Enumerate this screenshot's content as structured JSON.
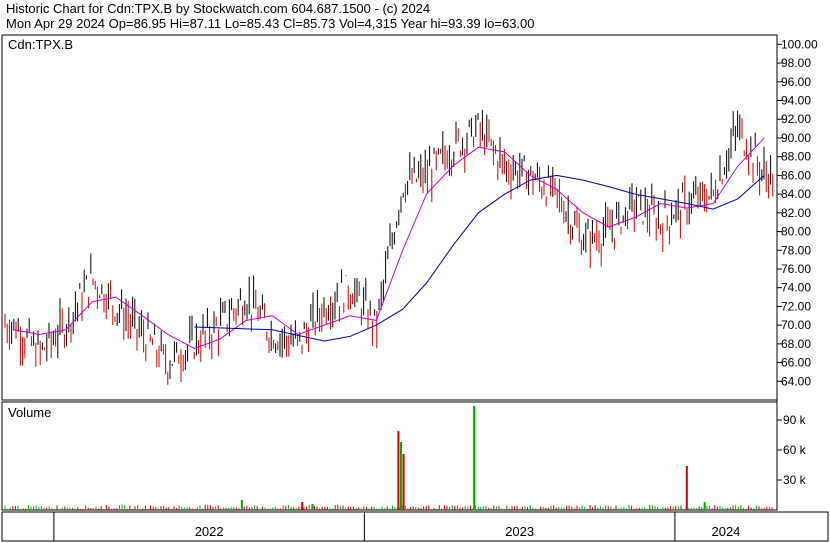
{
  "header": {
    "title_line": "Historic Chart for Cdn:TPX.B by Stockwatch.com 604.687.1500 - (c) 2024",
    "stats_line": "Mon Apr 29 2024   Op=86.95   Hi=87.11   Lo=85.43   Cl=85.73   Vol=4,315   Year hi=93.39   lo=63.00"
  },
  "colors": {
    "bar_up": "#000000",
    "bar_down": "#cc0000",
    "ma_short": "#cc00cc",
    "ma_long": "#0000aa",
    "volume_up": "#00aa00",
    "volume_down": "#cc0000",
    "frame": "#000000",
    "grid": "#c0c0c0"
  },
  "chart_data": [
    {
      "type": "line",
      "label": "Cdn:TPX.B",
      "y_axis_side": "right",
      "ylim": [
        62.0,
        101.0
      ],
      "yticks": [
        "100.00",
        "98.00",
        "96.00",
        "94.00",
        "92.00",
        "90.00",
        "88.00",
        "86.00",
        "84.00",
        "82.00",
        "80.00",
        "78.00",
        "76.00",
        "74.00",
        "72.00",
        "70.00",
        "68.00",
        "66.00",
        "64.00"
      ],
      "x_period_labels": [
        "2022",
        "2023",
        "2024"
      ],
      "series": [
        {
          "kind": "price",
          "x": [
            "2021-11",
            "2021-12",
            "2022-01",
            "2022-02",
            "2022-03",
            "2022-04",
            "2022-05",
            "2022-06",
            "2022-07",
            "2022-08",
            "2022-09",
            "2022-10",
            "2022-11",
            "2022-12",
            "2023-01",
            "2023-02",
            "2023-03",
            "2023-04",
            "2023-05",
            "2023-06",
            "2023-07",
            "2023-08",
            "2023-09",
            "2023-10",
            "2023-11",
            "2023-12",
            "2024-01",
            "2024-02",
            "2024-03",
            "2024-04"
          ],
          "values": [
            70,
            67,
            70,
            75,
            72,
            69,
            66,
            68,
            70,
            73,
            69,
            68,
            72,
            74,
            70,
            85,
            86,
            89,
            91,
            87,
            86,
            84,
            79,
            80,
            83,
            81,
            83,
            84,
            91,
            86
          ]
        },
        {
          "kind": "moving-average-short",
          "x": [
            "2021-11",
            "2021-12",
            "2022-01",
            "2022-02",
            "2022-03",
            "2022-04",
            "2022-05",
            "2022-06",
            "2022-07",
            "2022-08",
            "2022-09",
            "2022-10",
            "2022-11",
            "2022-12",
            "2023-01",
            "2023-02",
            "2023-03",
            "2023-04",
            "2023-05",
            "2023-06",
            "2023-07",
            "2023-08",
            "2023-09",
            "2023-10",
            "2023-11",
            "2023-12",
            "2024-01",
            "2024-02",
            "2024-03",
            "2024-04"
          ],
          "values": [
            69.5,
            69,
            69.5,
            72.5,
            73,
            71,
            69,
            67.5,
            68.5,
            70.5,
            71,
            69,
            70,
            71,
            70.5,
            78,
            84,
            87,
            89,
            88.5,
            86,
            84.5,
            82,
            80.5,
            81.5,
            83,
            82.5,
            83,
            87,
            90
          ]
        },
        {
          "kind": "moving-average-long",
          "x": [
            "2022-06",
            "2022-07",
            "2022-08",
            "2022-09",
            "2022-10",
            "2022-11",
            "2022-12",
            "2023-01",
            "2023-02",
            "2023-03",
            "2023-04",
            "2023-05",
            "2023-06",
            "2023-07",
            "2023-08",
            "2023-09",
            "2023-10",
            "2023-11",
            "2023-12",
            "2024-01",
            "2024-02",
            "2024-03",
            "2024-04"
          ],
          "values": [
            69.8,
            69.7,
            69.6,
            69.5,
            68.9,
            68.3,
            68.8,
            70,
            71.7,
            74.5,
            78.5,
            82,
            84,
            85.5,
            86,
            85.5,
            84.8,
            84,
            83.5,
            83,
            82.4,
            83.5,
            86
          ]
        }
      ]
    },
    {
      "type": "bar",
      "label": "Volume",
      "y_axis_side": "right",
      "ylim": [
        0,
        108
      ],
      "yticks": [
        "90 k",
        "60 k",
        "30 k"
      ],
      "x": [
        "2022-08-10",
        "2022-10-20",
        "2022-11-01",
        "2023-02-10",
        "2023-02-13",
        "2023-02-16",
        "2023-05-10",
        "2024-01-15",
        "2024-02-05"
      ],
      "values": [
        10,
        8,
        6,
        79,
        68,
        56,
        104,
        44,
        8
      ]
    }
  ]
}
